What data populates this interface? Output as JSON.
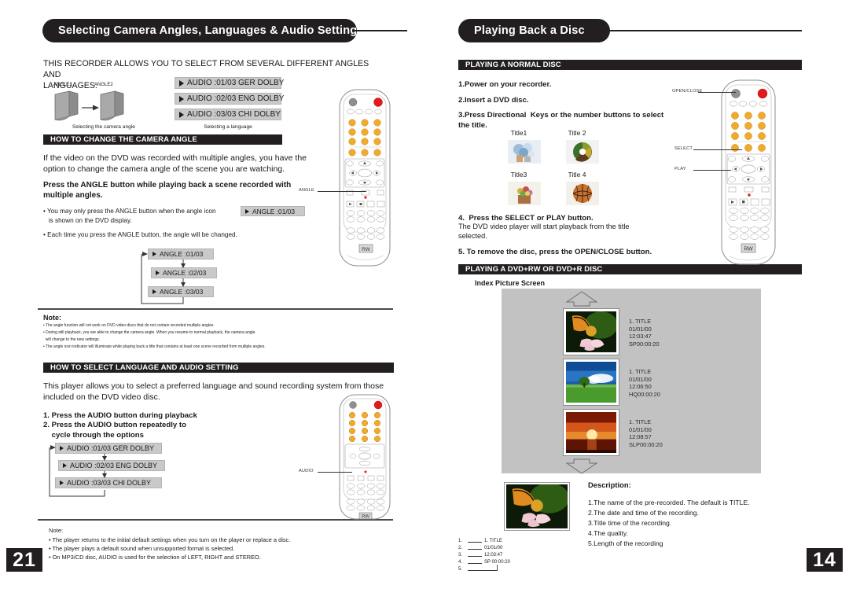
{
  "left_page": {
    "title": "Selecting Camera Angles, Languages & Audio Settings",
    "page_number": "21",
    "intro": "THIS RECORDER ALLOWS YOU TO SELECT FROM SEVERAL DIFFERENT ANGLES AND\nLANGUAGES.",
    "angle_diagram": {
      "label_1": "ANGLE1",
      "label_2": "ANGLE2",
      "caption": "Selecting the camera angle"
    },
    "language_demo": {
      "caption": "Selecting a language",
      "chips": [
        "AUDIO :01/03 GER DOLBY",
        "AUDIO :02/03 ENG DOLBY",
        "AUDIO :03/03 CHI DOLBY"
      ]
    },
    "section_camera_angle": {
      "header": "HOW TO CHANGE THE CAMERA ANGLE",
      "body": "If the video on the DVD was recorded with multiple angles, you have the\noption to change the camera angle of the scene you are watching.",
      "bold_instruction": "Press the ANGLE button while playing back a scene recorded with\nmultiple angles.",
      "bullet_1_a": "• You may only press the ANGLE button when the angle icon",
      "bullet_1_chip": "ANGLE :01/03",
      "bullet_1_b": "   is shown on the DVD display.",
      "bullet_2": "• Each time you press the ANGLE button, the angle will be changed.",
      "cycle_chips": [
        "ANGLE :01/03",
        "ANGLE :02/03",
        "ANGLE :03/03"
      ],
      "remote_callout": "ANGLE"
    },
    "note_1": {
      "heading": "Note:",
      "lines": [
        "• The angle function will not work on DVD video discs that do not contain recorded multiple angles.",
        "• During still playback, you are able to change the camera angle. When you resume to normal playback, the camera angle",
        "  will change to the new settings.",
        "• The angle icon indicator will illuminate while playing back a title that contains at least one scene recorded from multiple angles."
      ]
    },
    "section_language_audio": {
      "header": "HOW TO SELECT LANGUAGE AND  AUDIO SETTING",
      "body": "This player allows you to select a preferred language and sound recording system from those\nincluded on the DVD video disc.",
      "step_1": "1. Press the AUDIO button during playback",
      "step_2": "2. Press the AUDIO button repeatedly to\n    cycle through the options",
      "cycle_chips": [
        "AUDIO :01/03 GER DOLBY",
        "AUDIO :02/03 ENG DOLBY",
        "AUDIO :03/03 CHI DOLBY"
      ],
      "remote_callout": "AUDIO"
    },
    "note_2": {
      "heading": "Note:",
      "lines": [
        "• The player returns to the initial default settings when you turn on the player or replace a disc.",
        "• The player plays a default sound when unsupported format is selected.",
        "• On MP3/CD disc, AUDIO is used for the selection of LEFT, RIGHT and STEREO."
      ]
    }
  },
  "right_page": {
    "title": "Playing Back a Disc",
    "page_number": "14",
    "section_normal_disc": {
      "header": "PLAYING A NORMAL DISC",
      "step_1": "1.Power on your recorder.",
      "step_2": "2.Insert a DVD disc.",
      "step_3": "3.Press Directional  Keys or the number buttons to select\nthe title.",
      "titles": [
        "Title1",
        "Title 2",
        "Title3",
        "Title 4"
      ],
      "step_4_bold": "4.  Press the SELECT or PLAY button.",
      "step_4_body": "The DVD video player will start playback from the title\nselected.",
      "step_5": "5. To remove the disc, press the OPEN/CLOSE button.",
      "remote_callouts": [
        "OPEN/CLOSE",
        "SELECT",
        "PLAY"
      ]
    },
    "section_dvdrw": {
      "header": "PLAYING A DVD+RW OR DVD+R DISC",
      "subheading": "Index Picture Screen",
      "entries": [
        {
          "title": "1. TITLE",
          "date": "01/01/00",
          "time": "12:03:47",
          "quality": "SP00:00:20"
        },
        {
          "title": "1. TITLE",
          "date": "01/01/00",
          "time": "12:06:50",
          "quality": "HQ00:00:20"
        },
        {
          "title": "1. TITLE",
          "date": "01/01/00",
          "time": "12:08:57",
          "quality": "SLP00:00:20"
        }
      ],
      "callout_numbers": [
        "1.",
        "2.",
        "3.",
        "4.",
        "5."
      ],
      "callout_values": [
        "1. TITLE",
        "01/01/00",
        "12:03:47",
        "SP 00:00:20",
        ""
      ],
      "description": {
        "heading": "Description:",
        "items": [
          "1.The name of the pre-recorded. The default is TITLE.",
          "2.The date and time of the recording.",
          "3.Title time of the recording.",
          "4.The quality.",
          "5.Length of the recording"
        ]
      }
    }
  },
  "colors": {
    "ink": "#231f20",
    "osd_grey": "#c9c9c9",
    "screen_grey": "#c2c2c2"
  }
}
